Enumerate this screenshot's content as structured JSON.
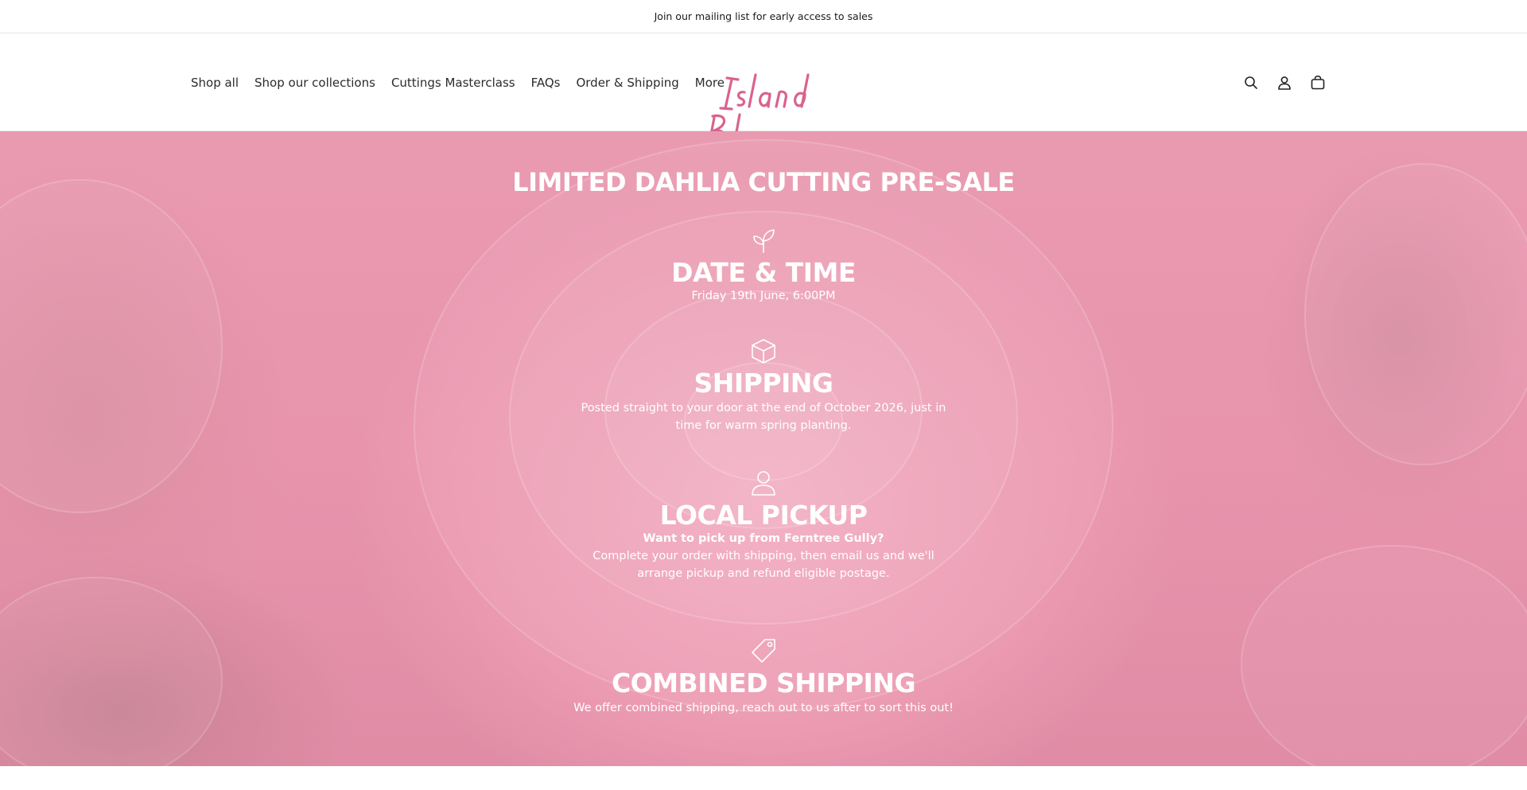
{
  "announcement": {
    "text": "Join our mailing list for early access to sales"
  },
  "nav": {
    "items": [
      {
        "label": "Shop all"
      },
      {
        "label": "Shop our collections"
      },
      {
        "label": "Cuttings Masterclass"
      },
      {
        "label": "FAQs"
      },
      {
        "label": "Order & Shipping"
      },
      {
        "label": "More"
      }
    ]
  },
  "logo": {
    "line1": "Island",
    "line2": "Bloomery",
    "color": "#d9638f"
  },
  "header_icons": [
    "search-icon",
    "account-icon",
    "cart-icon"
  ],
  "hero": {
    "title": "LIMITED DAHLIA CUTTING PRE-SALE",
    "blocks": [
      {
        "icon": "sprout-icon",
        "heading": "DATE & TIME",
        "text": "Friday 19th June, 6:00PM"
      },
      {
        "icon": "box-icon",
        "heading": "SHIPPING",
        "text": "Posted straight to your door at the end of October 2026, just in time for warm spring planting."
      },
      {
        "icon": "person-icon",
        "heading": "LOCAL PICKUP",
        "subheading": "Want to pick up from Ferntree Gully?",
        "text": "Complete your order with shipping, then email us and we'll arrange pickup and refund eligible postage."
      },
      {
        "icon": "tag-icon",
        "heading": "COMBINED SHIPPING",
        "text": "We offer combined shipping, reach out to us after to sort this out!"
      }
    ]
  },
  "colors": {
    "hero_tint": "#ec9db4",
    "text_on_hero": "#ffffff"
  }
}
